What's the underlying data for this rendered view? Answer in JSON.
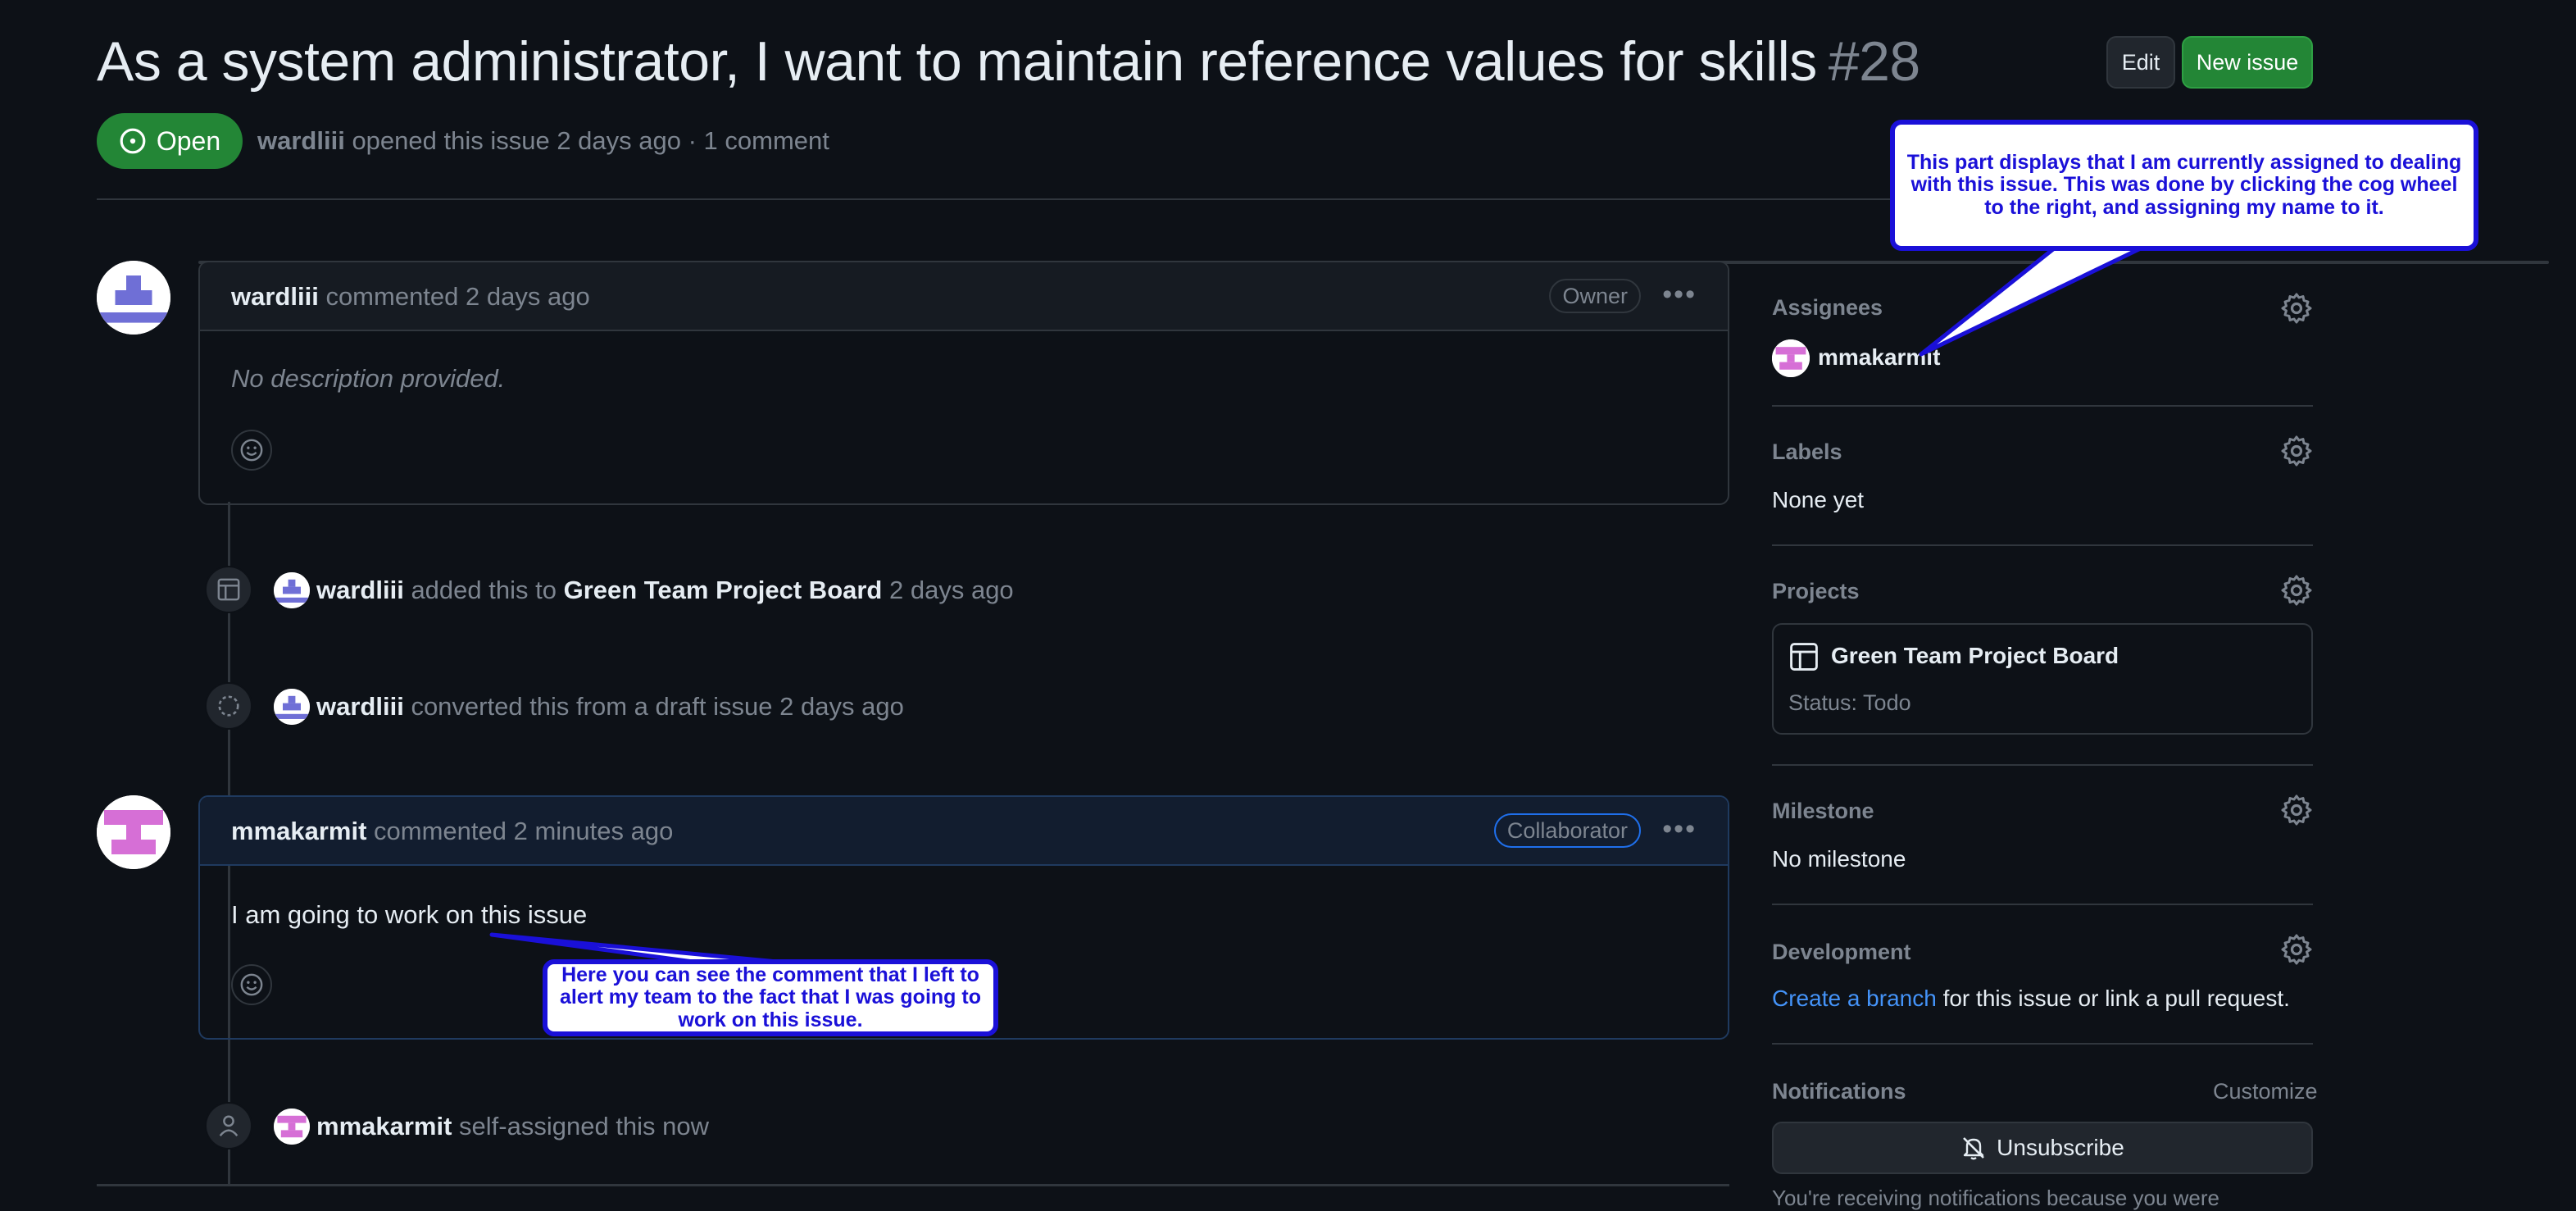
{
  "issue": {
    "title": "As a system administrator, I want to maintain reference values for skills",
    "number": "#28",
    "state": "Open",
    "author": "wardliii",
    "opened_text": "opened this issue 2 days ago · 1 comment"
  },
  "header": {
    "edit_label": "Edit",
    "new_issue_label": "New issue"
  },
  "comments": [
    {
      "author": "wardliii",
      "action": "commented 2 days ago",
      "role": "Owner",
      "body": "No description provided."
    },
    {
      "author": "mmakarmit",
      "action": "commented 2 minutes ago",
      "role": "Collaborator",
      "body": "I am going to work on this issue"
    }
  ],
  "events": [
    {
      "actor": "wardliii",
      "pre": "added this to",
      "target": "Green Team Project Board",
      "post": "2 days ago"
    },
    {
      "actor": "wardliii",
      "pre": "converted this from a draft issue 2 days ago"
    },
    {
      "actor": "mmakarmit",
      "pre": "self-assigned this now"
    }
  ],
  "sidebar": {
    "assignees": {
      "heading": "Assignees",
      "user": "mmakarmit"
    },
    "labels": {
      "heading": "Labels",
      "value": "None yet"
    },
    "projects": {
      "heading": "Projects",
      "board": "Green Team Project Board",
      "status": "Status: Todo"
    },
    "milestone": {
      "heading": "Milestone",
      "value": "No milestone"
    },
    "development": {
      "heading": "Development",
      "link": "Create a branch",
      "rest": "for this issue or link a pull request."
    },
    "notifications": {
      "heading": "Notifications",
      "customize": "Customize",
      "unsubscribe": "Unsubscribe",
      "note": "You're receiving notifications because you were"
    }
  },
  "callouts": {
    "assignee_note": "This part displays that I am currently assigned to dealing with this issue. This was done by clicking the cog wheel to the right, and assigning my name to it.",
    "comment_note": "Here you can see the comment that I left to alert my team to the fact that I was going to work on this issue."
  },
  "colors": {
    "background": "#0d1117",
    "open_green": "#238636",
    "link_blue": "#4493f8",
    "callout_blue": "#1a10d8",
    "avatar_wardliii": "#6f6fd6",
    "avatar_mmakarmit": "#d66fd6"
  }
}
